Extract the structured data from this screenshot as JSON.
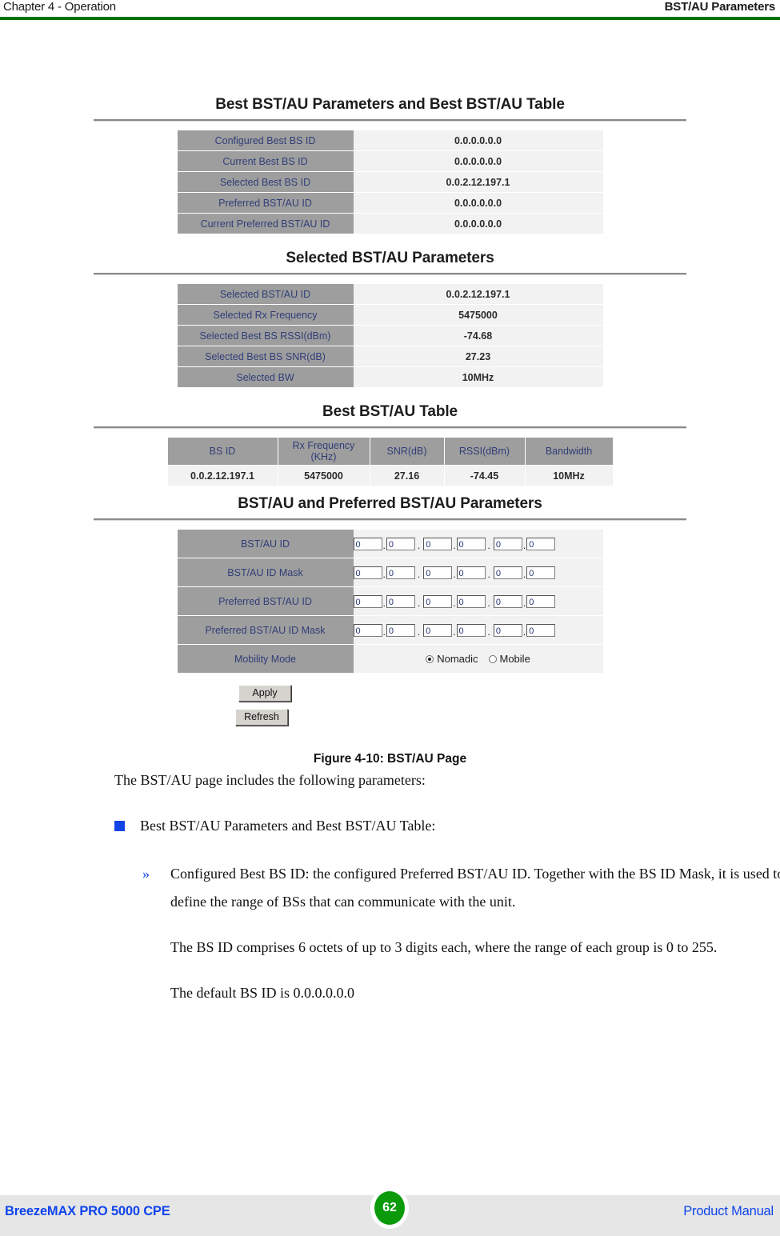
{
  "header": {
    "left": "Chapter 4 - Operation",
    "right": "BST/AU Parameters",
    "rule_color": "#007200"
  },
  "figure": {
    "caption": "Figure 4-10: BST/AU Page",
    "sections": [
      {
        "title": "Best BST/AU Parameters and Best BST/AU Table"
      },
      {
        "title": "Selected BST/AU Parameters"
      },
      {
        "title": "Best BST/AU Table"
      },
      {
        "title": "BST/AU and Preferred BST/AU Parameters"
      }
    ],
    "best_params": {
      "rows": [
        {
          "label": "Configured Best BS ID",
          "value": "0.0.0.0.0.0"
        },
        {
          "label": "Current Best BS ID",
          "value": "0.0.0.0.0.0"
        },
        {
          "label": "Selected Best BS ID",
          "value": "0.0.2.12.197.1"
        },
        {
          "label": "Preferred BST/AU ID",
          "value": "0.0.0.0.0.0"
        },
        {
          "label": "Current Preferred BST/AU ID",
          "value": "0.0.0.0.0.0"
        }
      ]
    },
    "selected_params": {
      "rows": [
        {
          "label": "Selected BST/AU ID",
          "value": "0.0.2.12.197.1"
        },
        {
          "label": "Selected Rx Frequency",
          "value": "5475000"
        },
        {
          "label": "Selected Best BS RSSI(dBm)",
          "value": "-74.68"
        },
        {
          "label": "Selected Best BS SNR(dB)",
          "value": "27.23"
        },
        {
          "label": "Selected BW",
          "value": "10MHz"
        }
      ]
    },
    "best_table": {
      "headers": [
        "BS ID",
        "Rx Frequency\n(KHz)",
        "SNR(dB)",
        "RSSI(dBm)",
        "Bandwidth"
      ],
      "header_line1": [
        "BS ID",
        "Rx Frequency",
        "SNR(dB)",
        "RSSI(dBm)",
        "Bandwidth"
      ],
      "header_line2": [
        "",
        "(KHz)",
        "",
        "",
        ""
      ],
      "rows": [
        [
          "0.0.2.12.197.1",
          "5475000",
          "27.16",
          "-74.45",
          "10MHz"
        ]
      ]
    },
    "form": {
      "rows": [
        {
          "label": "BST/AU ID",
          "octets": [
            "0",
            "0",
            "0",
            "0",
            "0",
            "0"
          ]
        },
        {
          "label": "BST/AU ID Mask",
          "octets": [
            "0",
            "0",
            "0",
            "0",
            "0",
            "0"
          ]
        },
        {
          "label": "Preferred BST/AU ID",
          "octets": [
            "0",
            "0",
            "0",
            "0",
            "0",
            "0"
          ]
        },
        {
          "label": "Preferred BST/AU ID Mask",
          "octets": [
            "0",
            "0",
            "0",
            "0",
            "0",
            "0"
          ]
        }
      ],
      "mobility": {
        "label": "Mobility Mode",
        "options": [
          {
            "label": "Nomadic",
            "selected": true
          },
          {
            "label": "Mobile",
            "selected": false
          }
        ]
      },
      "buttons": {
        "apply": "Apply",
        "refresh": "Refresh"
      }
    }
  },
  "body": {
    "intro": "The BST/AU page includes the following parameters:",
    "bullet1": "Best BST/AU Parameters and Best BST/AU Table:",
    "sub1": "Configured Best BS ID: the configured Preferred BST/AU ID. Together with the BS ID Mask, it is used to define the range of BSs that can communicate with the unit.",
    "sub2": "The BS ID comprises 6 octets of up to 3 digits each, where the range of each group is 0 to 255.",
    "sub3": "The default BS ID is 0.0.0.0.0.0",
    "chevron": "»"
  },
  "footer": {
    "left": "BreezeMAX PRO 5000 CPE",
    "page": "62",
    "right": "Product Manual",
    "badge_color": "#0a9a0a"
  }
}
